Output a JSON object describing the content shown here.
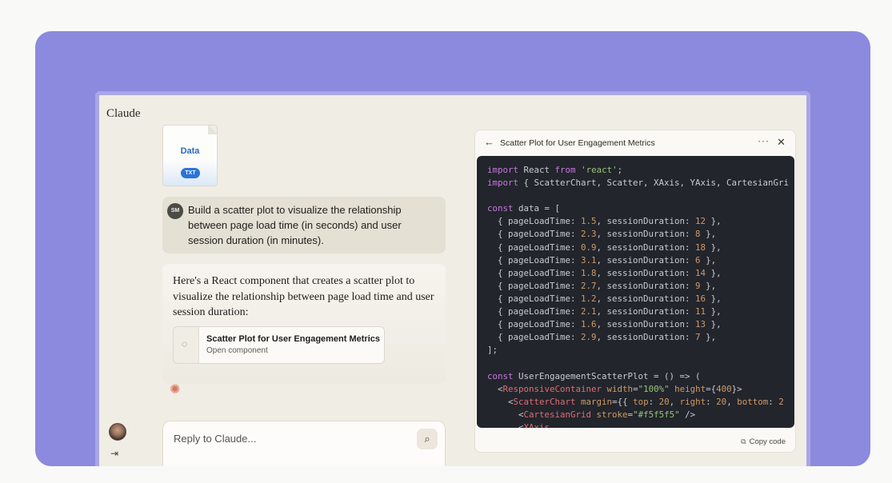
{
  "app": {
    "title": "Claude"
  },
  "attachment": {
    "name": "Data",
    "type": "TXT"
  },
  "user_message": {
    "initials": "SM",
    "text": "Build a scatter plot to visualize the relationship between page load time (in seconds) and user session duration (in minutes)."
  },
  "assistant_message": {
    "text": "Here's a React component that creates a scatter plot to visualize the relationship between page load time and user session duration:",
    "artifact": {
      "title": "Scatter Plot for User Engagement Metrics",
      "subtitle": "Open component"
    }
  },
  "reply": {
    "placeholder": "Reply to Claude..."
  },
  "panel": {
    "title": "Scatter Plot for User Engagement Metrics",
    "copy_label": "Copy code",
    "code": {
      "imports": [
        "import React from 'react';",
        "import { ScatterChart, Scatter, XAxis, YAxis, CartesianGri"
      ],
      "data": [
        {
          "pageLoadTime": "1.5",
          "sessionDuration": "12"
        },
        {
          "pageLoadTime": "2.3",
          "sessionDuration": "8"
        },
        {
          "pageLoadTime": "0.9",
          "sessionDuration": "18"
        },
        {
          "pageLoadTime": "3.1",
          "sessionDuration": "6"
        },
        {
          "pageLoadTime": "1.8",
          "sessionDuration": "14"
        },
        {
          "pageLoadTime": "2.7",
          "sessionDuration": "9"
        },
        {
          "pageLoadTime": "1.2",
          "sessionDuration": "16"
        },
        {
          "pageLoadTime": "2.1",
          "sessionDuration": "11"
        },
        {
          "pageLoadTime": "1.6",
          "sessionDuration": "13"
        },
        {
          "pageLoadTime": "2.9",
          "sessionDuration": "7"
        }
      ],
      "component_lines": [
        "const UserEngagementScatterPlot = () => (",
        "  <ResponsiveContainer width=\"100%\" height={400}>",
        "    <ScatterChart margin={{ top: 20, right: 20, bottom: 2",
        "      <CartesianGrid stroke=\"#f5f5f5\" />",
        "      <XAxis"
      ]
    }
  }
}
